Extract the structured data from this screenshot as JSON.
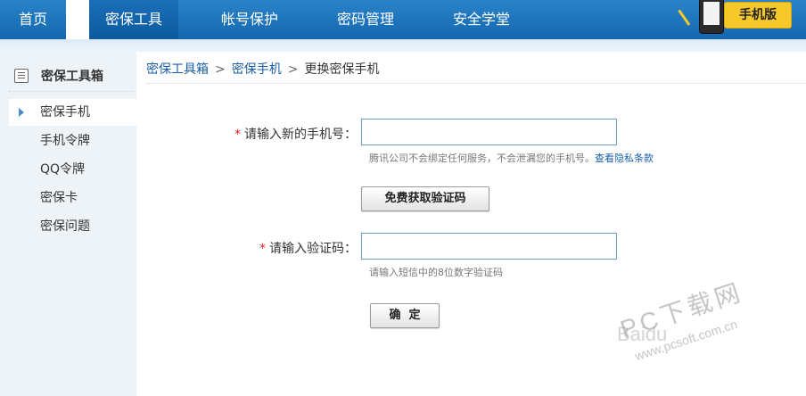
{
  "colors": {
    "nav_bg": "#1467ae",
    "accent_link": "#1a5ea8",
    "required_star": "#e02020",
    "badge_yellow": "#f6c829"
  },
  "nav": {
    "items": [
      {
        "label": "首页"
      },
      {
        "label": "密保工具"
      },
      {
        "label": "帐号保护"
      },
      {
        "label": "密码管理"
      },
      {
        "label": "安全学堂"
      }
    ],
    "badge_label": "手机版",
    "badge_icon": "mobile-phone-icon"
  },
  "sidebar": {
    "title": "密保工具箱",
    "title_icon": "toolbox-icon",
    "items": [
      {
        "label": "密保手机"
      },
      {
        "label": "手机令牌"
      },
      {
        "label": "QQ令牌"
      },
      {
        "label": "密保卡"
      },
      {
        "label": "密保问题"
      }
    ]
  },
  "breadcrumb": {
    "item1": "密保工具箱",
    "item2": "密保手机",
    "current": "更换密保手机",
    "separator": ">"
  },
  "form": {
    "phone_label": "请输入新的手机号：",
    "phone_value": "",
    "phone_hint": "腾讯公司不会绑定任何服务，不会泄漏您的手机号。",
    "privacy_link": "查看隐私条款",
    "get_code_button": "免费获取验证码",
    "code_label": "请输入验证码：",
    "code_value": "",
    "code_hint": "请输入短信中的8位数字验证码",
    "confirm_button": "确  定",
    "required_mark": "*"
  },
  "watermark": {
    "text": "PC下载网",
    "url": "www.pcsoft.com.cn",
    "baidu": "Baidu"
  }
}
